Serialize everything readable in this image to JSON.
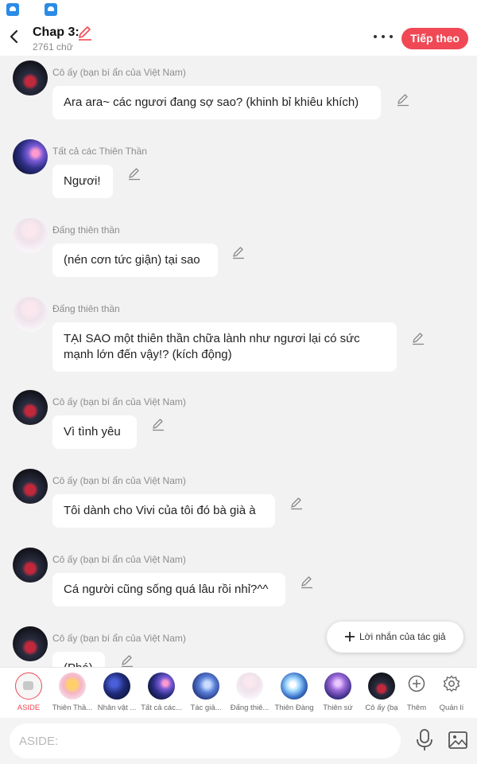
{
  "header": {
    "title": "Chap 3:",
    "subtitle": "2761 chữ",
    "next_label": "Tiếp theo"
  },
  "messages": [
    {
      "sender": "Cô ấy (bạn bí ẩn của Việt Nam)",
      "text": "Ara ara~ các ngươi đang sợ sao? (khinh bỉ khiêu khích)",
      "avatar": "red-hero"
    },
    {
      "sender": "Tất cả các Thiên Thần",
      "text": "Ngươi!",
      "avatar": "galaxy"
    },
    {
      "sender": "Đấng thiên thần",
      "text": "(nén cơn tức giận) tại sao",
      "avatar": "angel"
    },
    {
      "sender": "Đấng thiên thần",
      "text": "TẠI SAO một thiên thần chữa lành như ngươi lại có sức mạnh lớn đến vậy!? (kích động)",
      "avatar": "angel"
    },
    {
      "sender": "Cô ấy (bạn bí ẩn của Việt Nam)",
      "text": "Vì tình yêu",
      "avatar": "red-hero"
    },
    {
      "sender": "Cô ấy (bạn bí ẩn của Việt Nam)",
      "text": "Tôi dành cho Vivi của tôi đó bà già à",
      "avatar": "red-hero"
    },
    {
      "sender": "Cô ấy (bạn bí ẩn của Việt Nam)",
      "text": "Cá người cũng sống quá lâu rồi nhỉ?^^",
      "avatar": "red-hero"
    },
    {
      "sender": "Cô ấy (bạn bí ẩn của Việt Nam)",
      "text": "(Phá)",
      "avatar": "red-hero"
    }
  ],
  "author_note": {
    "label": "Lời nhắn của tác giả"
  },
  "characters": [
    {
      "label": "ASIDE"
    },
    {
      "label": "Thiên Thầ..."
    },
    {
      "label": "Nhân vật ..."
    },
    {
      "label": "Tất cả các..."
    },
    {
      "label": "Tác giả..."
    },
    {
      "label": "Đấng thiê..."
    },
    {
      "label": "Thiên Đàng"
    },
    {
      "label": "Thiên sứ"
    },
    {
      "label": "Cô ấy (bạ"
    }
  ],
  "actions": {
    "add_label": "Thêm",
    "manage_label": "Quản lí"
  },
  "input": {
    "placeholder": "ASIDE:"
  },
  "colors": {
    "accent": "#f04854",
    "background": "#f2f2f2",
    "bubble": "#ffffff"
  }
}
